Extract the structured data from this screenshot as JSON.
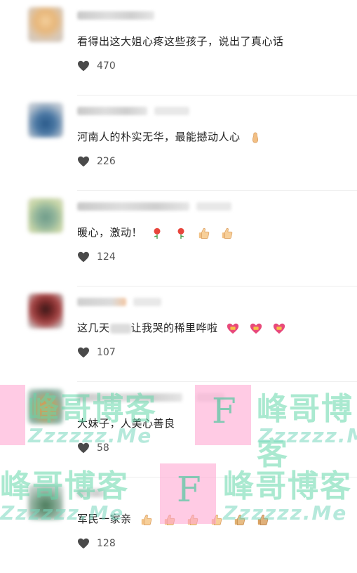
{
  "comments": [
    {
      "text": "看得出这大姐心疼这些孩子，说出了真心话",
      "likes": "470"
    },
    {
      "text": "河南人的朴实无华，最能撼动人心",
      "likes": "226"
    },
    {
      "text": "暖心，激动！",
      "likes": "124"
    },
    {
      "text_before": "这几天",
      "text_after": "让我哭的稀里哗啦",
      "likes": "107"
    },
    {
      "text": "大妹子，人美心善良",
      "likes": "58"
    },
    {
      "text": "军民一家亲",
      "likes": "128"
    }
  ],
  "watermark": {
    "brand_cn": "峰哥博客",
    "brand_en": "Zzzzzz.Me",
    "logo_letter": "F"
  },
  "icons": {
    "like": "heart-icon",
    "emojis": [
      "pinched-fingers-emoji",
      "rose-emoji",
      "thumbs-up-emoji",
      "heart-gift-emoji"
    ]
  },
  "colors": {
    "text": "#222222",
    "like_count": "#555555",
    "divider": "#eeeeee",
    "watermark_pink": "#ffa0cd",
    "watermark_green": "#64d7aa"
  }
}
